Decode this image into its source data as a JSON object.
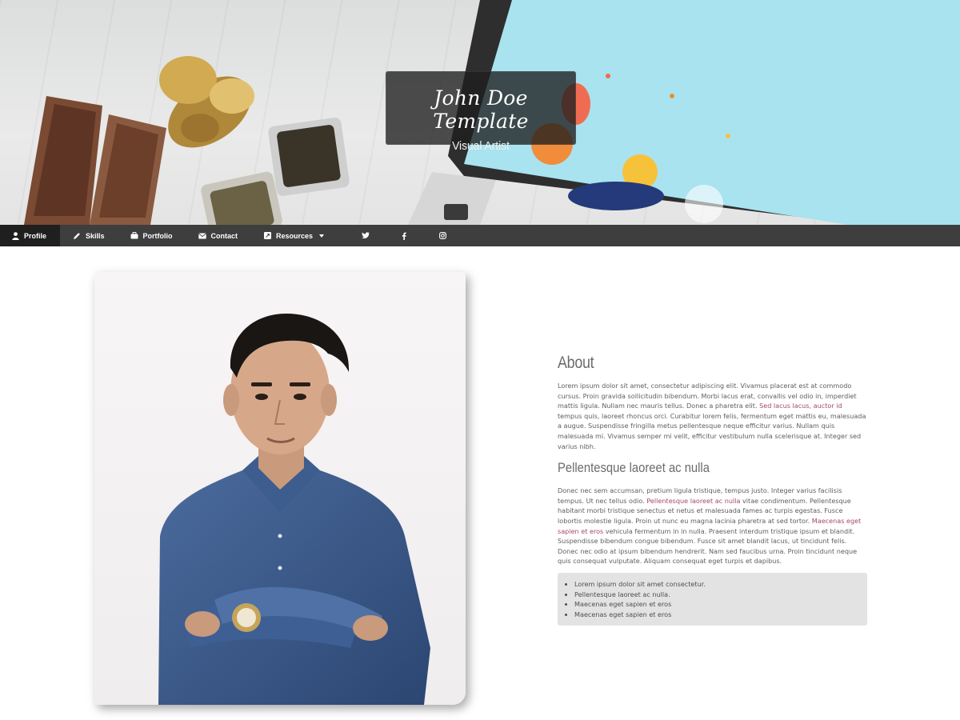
{
  "header": {
    "title": "John Doe Template",
    "subtitle": "Visual Artist"
  },
  "nav": {
    "items": [
      {
        "label": "Profile",
        "icon": "user-icon",
        "active": true
      },
      {
        "label": "Skills",
        "icon": "pencil-icon",
        "active": false
      },
      {
        "label": "Portfolio",
        "icon": "briefcase-icon",
        "active": false
      },
      {
        "label": "Contact",
        "icon": "envelope-icon",
        "active": false
      },
      {
        "label": "Resources",
        "icon": "external-link-icon",
        "active": false,
        "dropdown": true
      }
    ],
    "social": [
      "twitter-icon",
      "facebook-icon",
      "instagram-icon"
    ]
  },
  "about": {
    "heading": "About",
    "p1": {
      "before": "Lorem ipsum dolor sit amet, consectetur adipiscing elit. Vivamus placerat est at commodo cursus. Proin gravida sollicitudin bibendum. Morbi lacus erat, convallis vel odio in, imperdiet mattis ligula. Nullam nec mauris tellus. Donec a pharetra elit. ",
      "link": "Sed lacus lacus, auctor id",
      "after": " tempus quis, laoreet rhoncus orci. Curabitur lorem felis, fermentum eget mattis eu, malesuada a augue. Suspendisse fringilla metus pellentesque neque efficitur varius. Nullam quis malesuada mi. Vivamus semper mi velit, efficitur vestibulum nulla scelerisque at. Integer sed varius nibh."
    },
    "subheading": "Pellentesque laoreet ac nulla",
    "p2": {
      "part1": "Donec nec sem accumsan, pretium ligula tristique, tempus justo. Integer varius facilisis tempus. Ut nec tellus odio. ",
      "link1": "Pellentesque laoreet ac nulla",
      "part2": " vitae condimentum. Pellentesque habitant morbi tristique senectus et netus et malesuada fames ac turpis egestas. Fusce lobortis molestie ligula. Proin ut nunc eu magna lacinia pharetra at sed tortor. ",
      "link2": "Maecenas eget sapien et eros",
      "part3": " vehicula fermentum in in nulla. Praesent interdum tristique ipsum et blandit. Suspendisse bibendum congue bibendum. Fusce sit amet blandit lacus, ut tincidunt felis. Donec nec odio at ipsum bibendum hendrerit. Nam sed faucibus urna. Proin tincidunt neque quis consequat vulputate. Aliquam consequat eget turpis et dapibus."
    },
    "list": [
      "Lorem ipsum dolor sit amet consectetur.",
      "Pellentesque laoreet ac nulla.",
      "Maecenas eget sapien et eros",
      "Maecenas eget sapien et eros"
    ]
  },
  "colors": {
    "nav_bg": "#3e3e3e",
    "nav_active_bg": "#1f1f1f",
    "link": "#a7496c",
    "list_bg": "#e3e3e3"
  }
}
